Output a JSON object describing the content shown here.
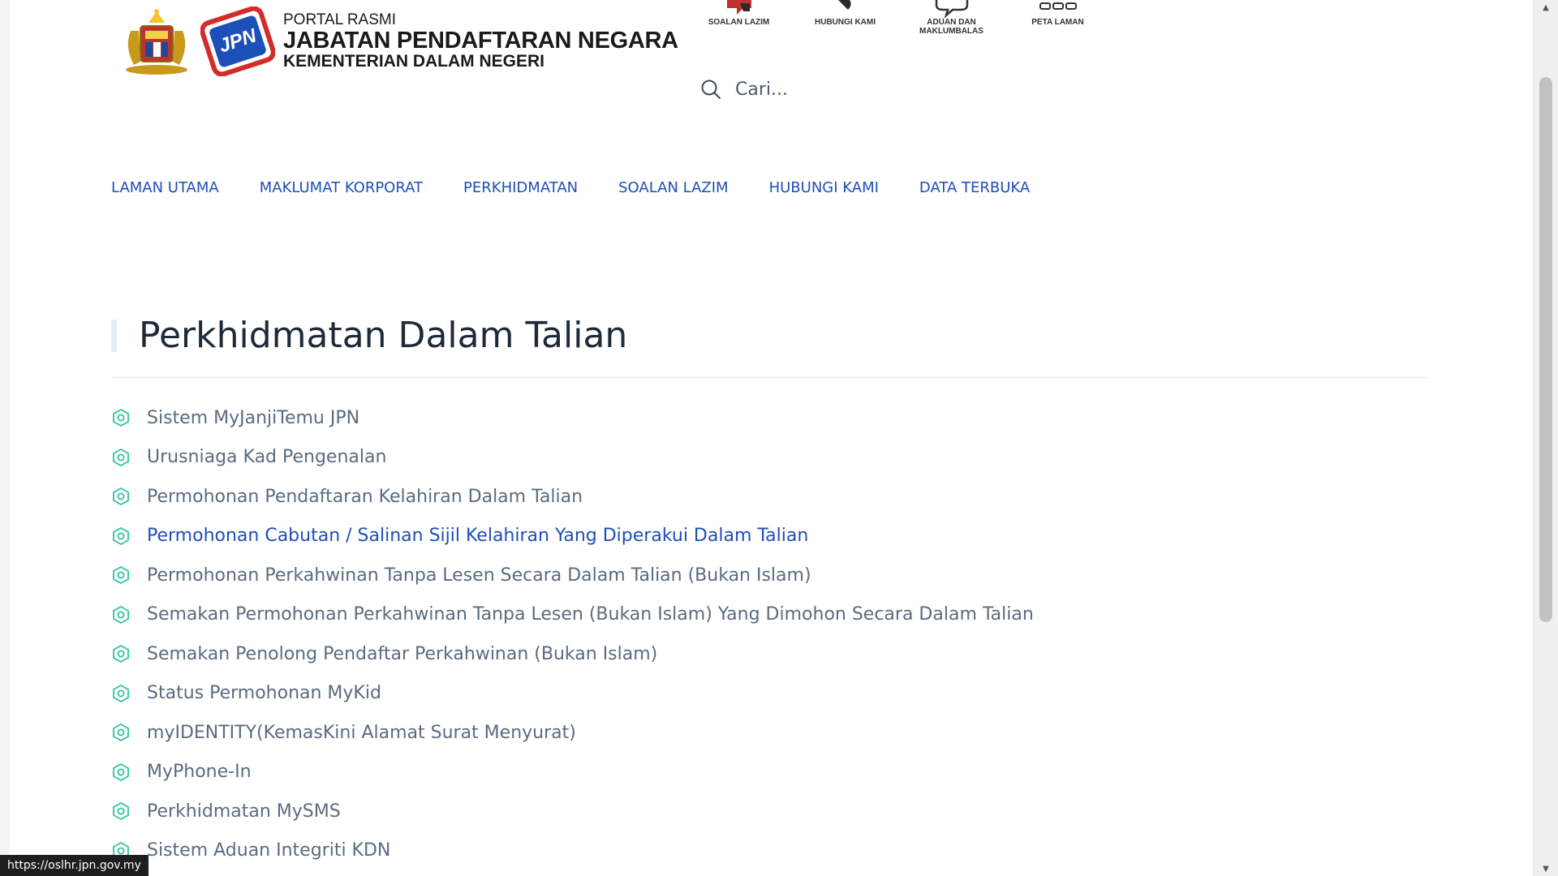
{
  "header": {
    "logo_line1": "PORTAL RASMI",
    "logo_line2": "JABATAN PENDAFTARAN NEGARA",
    "logo_line3": "KEMENTERIAN DALAM NEGERI",
    "jpn_badge": "JPN",
    "quick_links": [
      {
        "label": "SOALAN LAZIM",
        "icon": "faq-icon"
      },
      {
        "label": "HUBUNGI KAMI",
        "icon": "phone-icon"
      },
      {
        "label": "ADUAN DAN MAKLUMBALAS",
        "icon": "chat-bubble-icon"
      },
      {
        "label": "PETA LAMAN",
        "icon": "sitemap-icon"
      }
    ],
    "search_placeholder": "Cari..."
  },
  "nav": {
    "items": [
      "LAMAN UTAMA",
      "MAKLUMAT KORPORAT",
      "PERKHIDMATAN",
      "SOALAN LAZIM",
      "HUBUNGI KAMI",
      "DATA TERBUKA"
    ]
  },
  "main": {
    "title": "Perkhidmatan Dalam Talian",
    "services": [
      "Sistem MyJanjiTemu JPN",
      "Urusniaga Kad Pengenalan",
      "Permohonan Pendaftaran Kelahiran Dalam Talian",
      "Permohonan Cabutan / Salinan Sijil Kelahiran Yang Diperakui Dalam Talian",
      "Permohonan Perkahwinan Tanpa Lesen Secara Dalam Talian (Bukan Islam)",
      "Semakan Permohonan Perkahwinan Tanpa Lesen (Bukan Islam) Yang Dimohon Secara Dalam Talian",
      "Semakan Penolong Pendaftar Perkahwinan (Bukan Islam)",
      "Status Permohonan MyKid",
      "myIDENTITY(KemasKini Alamat Surat Menyurat)",
      "MyPhone-In",
      "Perkhidmatan MySMS",
      "Sistem Aduan Integriti KDN"
    ],
    "hovered_index": 3
  },
  "status_bar": {
    "url": "https://oslhr.jpn.gov.my"
  },
  "colors": {
    "nav_link": "#1d4fb8",
    "service_text": "#5a6b80",
    "service_icon": "#2ec4a2",
    "title": "#1e2a3a"
  }
}
